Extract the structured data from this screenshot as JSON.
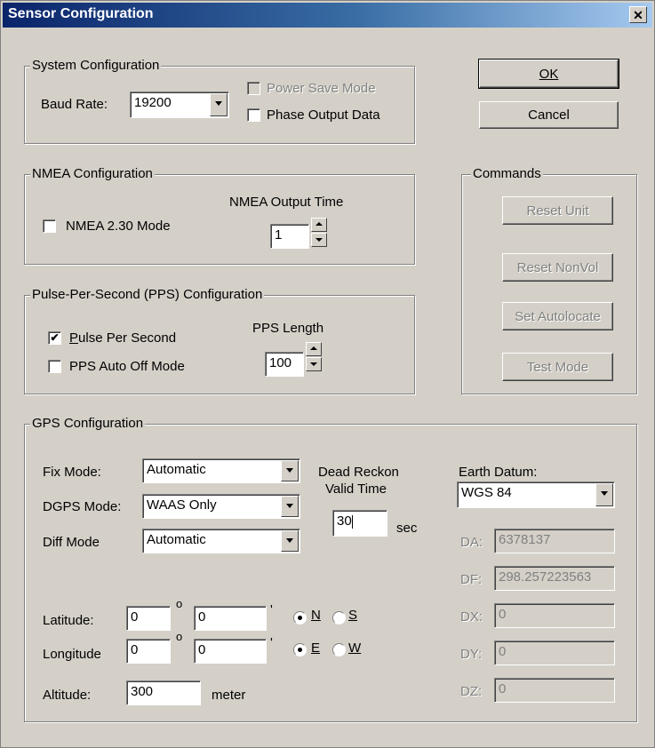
{
  "window": {
    "title": "Sensor Configuration",
    "close": "✕"
  },
  "buttons": {
    "ok": "OK",
    "cancel": "Cancel"
  },
  "system": {
    "legend": "System Configuration",
    "baud_label": "Baud Rate:",
    "baud_value": "19200",
    "power_save": "Power Save Mode",
    "phase_output": "Phase Output Data"
  },
  "nmea": {
    "legend": "NMEA Configuration",
    "mode_label": "NMEA 2.30 Mode",
    "output_time_label": "NMEA Output Time",
    "output_time_value": "1"
  },
  "pps": {
    "legend": "Pulse-Per-Second (PPS) Configuration",
    "pps_label": "Pulse Per Second",
    "pps_checked": "✔",
    "auto_off_label": "PPS Auto Off Mode",
    "length_label": "PPS Length",
    "length_value": "100"
  },
  "commands": {
    "legend": "Commands",
    "reset_unit": "Reset Unit",
    "reset_nonvol": "Reset NonVol",
    "set_autolocate": "Set Autolocate",
    "test_mode": "Test Mode"
  },
  "gps": {
    "legend": "GPS Configuration",
    "fix_mode_label": "Fix Mode:",
    "fix_mode_value": "Automatic",
    "dgps_mode_label": "DGPS Mode:",
    "dgps_mode_value": "WAAS Only",
    "diff_mode_label": "Diff Mode",
    "diff_mode_value": "Automatic",
    "dead_reckon_line1": "Dead Reckon",
    "dead_reckon_line2": "Valid Time",
    "dead_reckon_value": "30",
    "sec_label": "sec",
    "latitude_label": "Latitude:",
    "lat_deg": "0",
    "lat_min": "0",
    "longitude_label": "Longitude",
    "lon_deg": "0",
    "lon_min": "0",
    "degree_symbol": "o",
    "minute_symbol": "'",
    "n_label": "N",
    "s_label": "S",
    "e_label": "E",
    "w_label": "W",
    "altitude_label": "Altitude:",
    "altitude_value": "300",
    "meter_label": "meter",
    "datum_label": "Earth Datum:",
    "datum_value": "WGS 84",
    "da_label": "DA:",
    "da_value": "6378137",
    "df_label": "DF:",
    "df_value": "298.257223563",
    "dx_label": "DX:",
    "dx_value": "0",
    "dy_label": "DY:",
    "dy_value": "0",
    "dz_label": "DZ:",
    "dz_value": "0"
  }
}
